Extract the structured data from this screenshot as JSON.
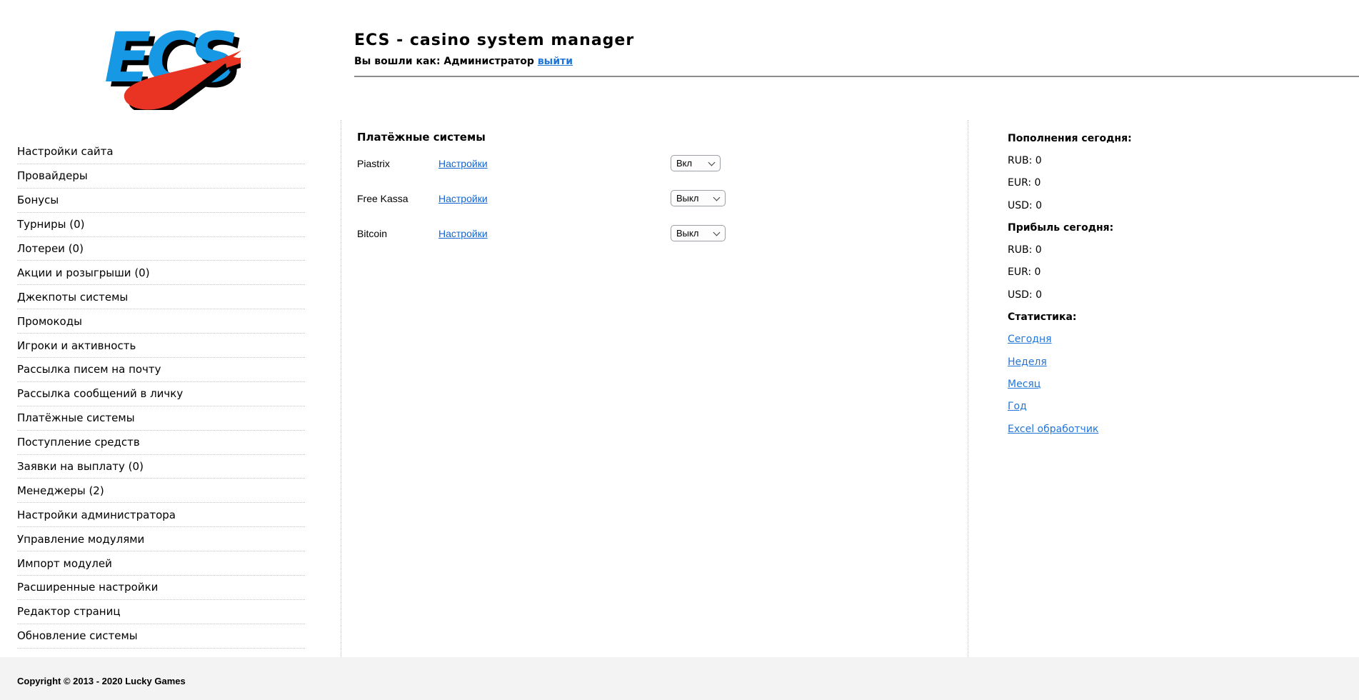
{
  "header": {
    "logo_text": "ECS",
    "title": "ECS - casino system manager",
    "logged_in_label": "Вы вошли как: Администратор",
    "logout_label": "выйти"
  },
  "sidebar": {
    "items": [
      "Настройки сайта",
      "Провайдеры",
      "Бонусы",
      "Турниры (0)",
      "Лотереи (0)",
      "Акции и розыгрыши (0)",
      "Джекпоты системы",
      "Промокоды",
      "Игроки и активность",
      "Рассылка писем на почту",
      "Рассылка сообщений в личку",
      "Платёжные системы",
      "Поступление средств",
      "Заявки на выплату (0)",
      "Менеджеры (2)",
      "Настройки администратора",
      "Управление модулями",
      "Импорт модулей",
      "Расширенные настройки",
      "Редактор страниц",
      "Обновление системы"
    ]
  },
  "main": {
    "title": "Платёжные системы",
    "rows": [
      {
        "name": "Piastrix",
        "settings_label": "Настройки",
        "state": "Вкл"
      },
      {
        "name": "Free Kassa",
        "settings_label": "Настройки",
        "state": "Выкл"
      },
      {
        "name": "Bitcoin",
        "settings_label": "Настройки",
        "state": "Выкл"
      }
    ]
  },
  "stats": {
    "deposits_title": "Пополнения сегодня:",
    "deposits": [
      "RUB: 0",
      "EUR: 0",
      "USD: 0"
    ],
    "profit_title": "Прибыль сегодня:",
    "profit": [
      "RUB: 0",
      "EUR: 0",
      "USD: 0"
    ],
    "statistics_title": "Статистика:",
    "links": [
      "Сегодня",
      "Неделя",
      "Месяц",
      "Год",
      "Excel обработчик"
    ]
  },
  "footer": {
    "copyright": "Copyright © 2013 - 2020 Lucky Games"
  },
  "colors": {
    "logo_blue": "#1798e5",
    "logo_red": "#e93323",
    "link_blue_sans": "#1465cf",
    "link_blue_comic": "#2176d9",
    "header_rule": "#8c8c8c",
    "divider_dotted": "#c4c4c4",
    "footer_bg": "#f3f3f3"
  }
}
